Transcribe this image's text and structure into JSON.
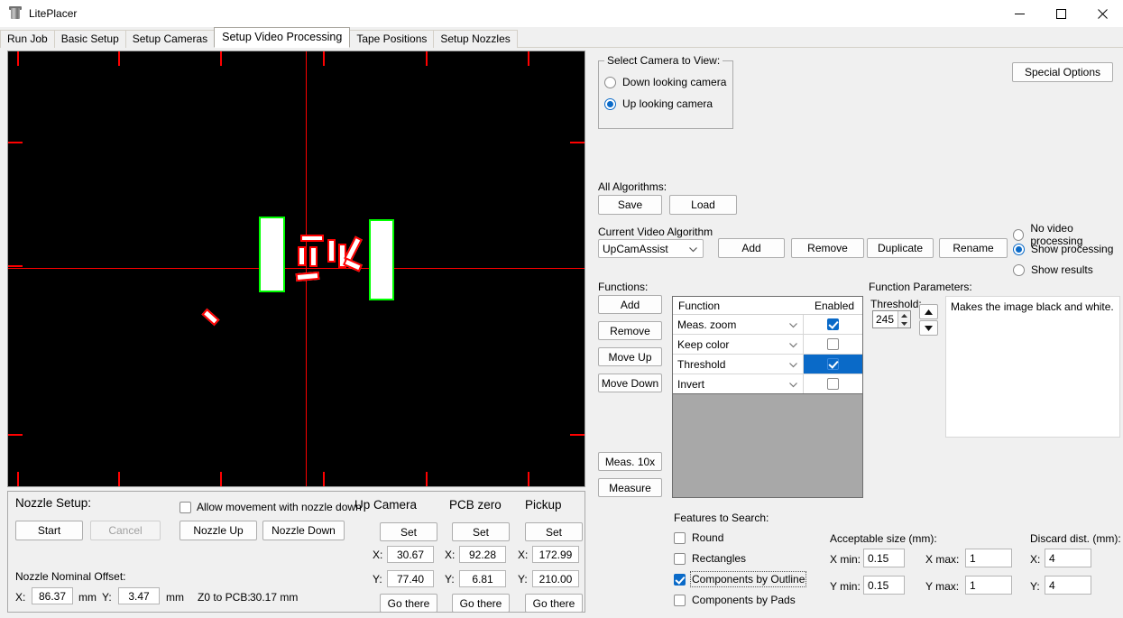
{
  "window": {
    "title": "LitePlacer",
    "icon": "app-icon",
    "controls": {
      "minimize": "minimize-icon",
      "maximize": "maximize-icon",
      "close": "close-icon"
    }
  },
  "tabs": [
    {
      "label": "Run Job",
      "active": false
    },
    {
      "label": "Basic Setup",
      "active": false
    },
    {
      "label": "Setup Cameras",
      "active": false
    },
    {
      "label": "Setup Video Processing",
      "active": true
    },
    {
      "label": "Tape Positions",
      "active": false
    },
    {
      "label": "Setup Nozzles",
      "active": false
    }
  ],
  "camera_view": {
    "name": "camera-video-feed",
    "background": "#000000",
    "crosshair_color": "#ff0000",
    "detected_outline_color": "#00ff00",
    "feature_outline_color": "#ff0000"
  },
  "select_camera": {
    "title": "Select Camera to View:",
    "options": [
      {
        "label": "Down looking camera",
        "selected": false
      },
      {
        "label": "Up looking camera",
        "selected": true
      }
    ]
  },
  "special_options_button": "Special Options",
  "all_algorithms": {
    "label": "All Algorithms:",
    "save": "Save",
    "load": "Load"
  },
  "current_algorithm": {
    "label": "Current Video Algorithm",
    "value": "UpCamAssist",
    "add": "Add",
    "remove": "Remove",
    "duplicate": "Duplicate",
    "rename": "Rename"
  },
  "display_mode": {
    "options": [
      {
        "label": "No video processing",
        "selected": false
      },
      {
        "label": "Show processing",
        "selected": true
      },
      {
        "label": "Show results",
        "selected": false
      }
    ]
  },
  "functions": {
    "label": "Functions:",
    "buttons": {
      "add": "Add",
      "remove": "Remove",
      "move_up": "Move Up",
      "move_down": "Move Down",
      "meas_10x": "Meas. 10x",
      "measure": "Measure"
    },
    "columns": [
      "Function",
      "Enabled"
    ],
    "rows": [
      {
        "name": "Meas. zoom",
        "enabled": true,
        "selected": false
      },
      {
        "name": "Keep color",
        "enabled": false,
        "selected": false
      },
      {
        "name": "Threshold",
        "enabled": true,
        "selected": true
      },
      {
        "name": "Invert",
        "enabled": false,
        "selected": false
      }
    ]
  },
  "function_parameters": {
    "label": "Function Parameters:",
    "threshold_label": "Threshold:",
    "threshold_value": "245",
    "description": "Makes the image black and white."
  },
  "features_to_search": {
    "label": "Features to Search:",
    "items": [
      {
        "label": "Round",
        "checked": false,
        "focused": false
      },
      {
        "label": "Rectangles",
        "checked": false,
        "focused": false
      },
      {
        "label": "Components by Outline",
        "checked": true,
        "focused": true
      },
      {
        "label": "Components by Pads",
        "checked": false,
        "focused": false
      }
    ]
  },
  "acceptable_size": {
    "label": "Acceptable size (mm):",
    "x_min_label": "X min:",
    "x_min": "0.15",
    "y_min_label": "Y min:",
    "y_min": "0.15",
    "x_max_label": "X max:",
    "x_max": "1",
    "y_max_label": "Y max:",
    "y_max": "1"
  },
  "discard_dist": {
    "label": "Discard dist. (mm):",
    "x_label": "X:",
    "x": "4",
    "y_label": "Y:",
    "y": "4"
  },
  "nozzle_setup": {
    "title": "Nozzle Setup:",
    "start": "Start",
    "cancel": "Cancel",
    "allow_movement": {
      "label": "Allow movement with nozzle down",
      "checked": false
    },
    "nozzle_up": "Nozzle Up",
    "nozzle_down": "Nozzle Down",
    "nominal_offset_label": "Nozzle Nominal Offset:",
    "offset_x_label": "X:",
    "offset_x": "86.37",
    "offset_x_unit": "mm",
    "offset_y_label": "Y:",
    "offset_y": "3.47",
    "offset_y_unit": "mm",
    "z0_label": "Z0 to PCB:",
    "z0_value": "30.17 mm",
    "columns": [
      {
        "header": "Up Camera",
        "set": "Set",
        "x_label": "X:",
        "x": "30.67",
        "y_label": "Y:",
        "y": "77.40",
        "go": "Go there"
      },
      {
        "header": "PCB zero",
        "set": "Set",
        "x_label": "X:",
        "x": "92.28",
        "y_label": "Y:",
        "y": "6.81",
        "go": "Go there"
      },
      {
        "header": "Pickup",
        "set": "Set",
        "x_label": "X:",
        "x": "172.99",
        "y_label": "Y:",
        "y": "210.00",
        "go": "Go there"
      }
    ]
  },
  "colors": {
    "accent": "#0a6ac8",
    "window_bg": "#f0f0f0",
    "camera_bg": "#000000",
    "crosshair": "#ff0000",
    "outline_green": "#00ff00"
  }
}
